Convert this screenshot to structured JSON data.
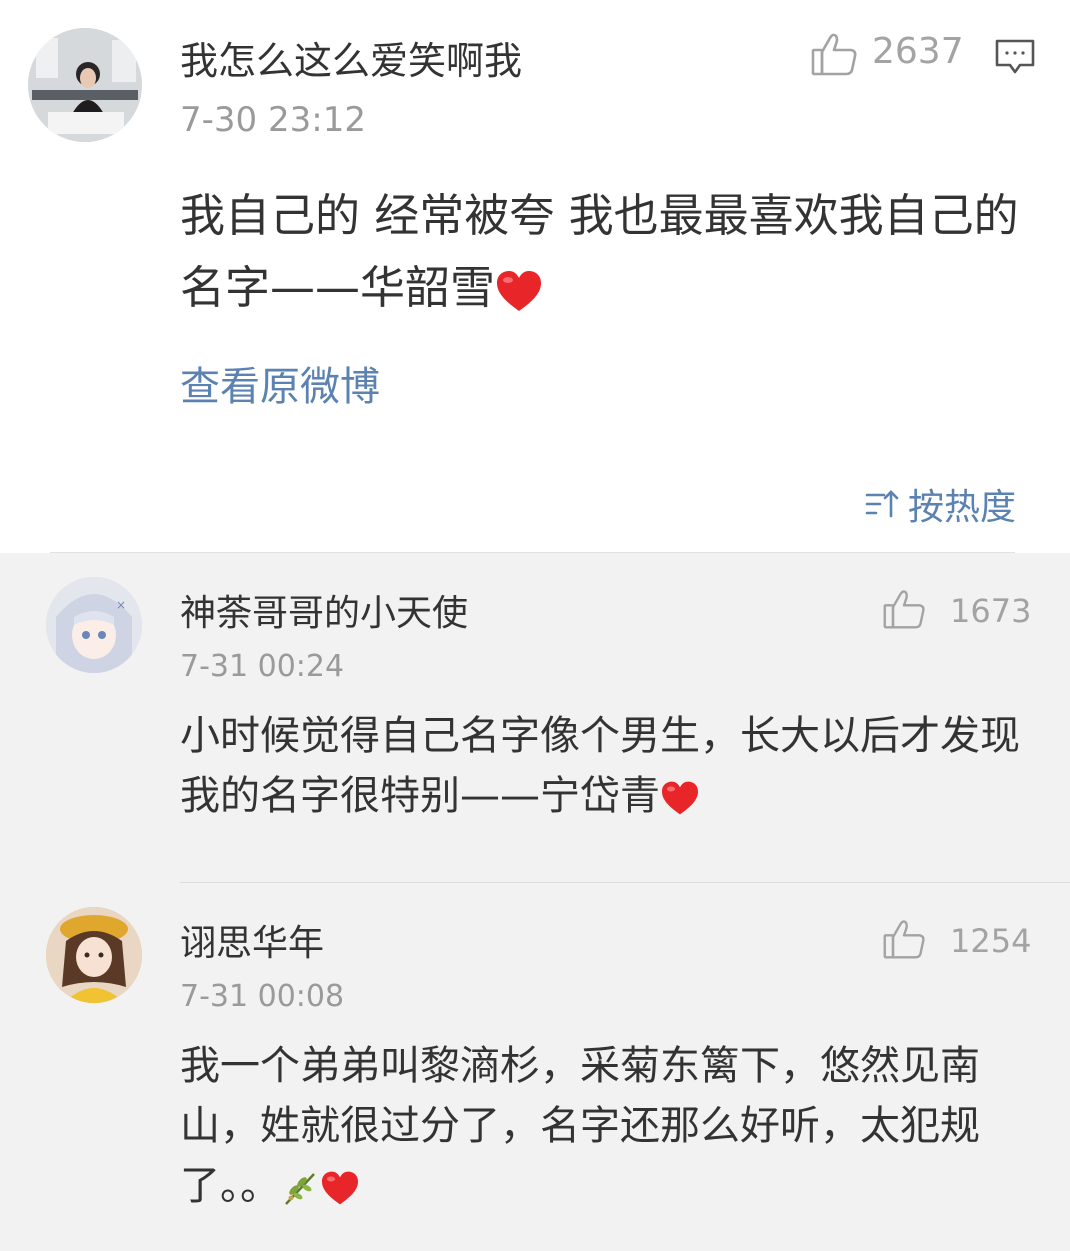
{
  "post": {
    "author": "我怎么这么爱笑啊我",
    "timestamp": "7-30 23:12",
    "like_count": "2637",
    "content_text": "我自己的 经常被夸 我也最最喜欢我自己的名字——华韶雪",
    "content_emoji": "heart-icon",
    "view_original_label": "查看原微博",
    "sort_label": "按热度"
  },
  "replies": [
    {
      "author": "神荼哥哥的小天使",
      "timestamp": "7-31 00:24",
      "like_count": "1673",
      "content_text": "小时候觉得自己名字像个男生，长大以后才发现我的名字很特别——宁岱青",
      "content_emoji": "heart-icon"
    },
    {
      "author": "诩思华年",
      "timestamp": "7-31 00:08",
      "like_count": "1254",
      "content_text": "我一个弟弟叫黎滳杉，采菊东篱下，悠然见南山，姓就很过分了，名字还那么好听，太犯规了。。",
      "content_emoji": [
        "olive-branch-icon",
        "heart-icon"
      ]
    }
  ],
  "colors": {
    "link_blue": "#5b82b0",
    "text_main": "#333333",
    "text_muted": "#9a9a9a",
    "reply_bg": "#f2f2f2",
    "heart_red": "#e8262a"
  }
}
